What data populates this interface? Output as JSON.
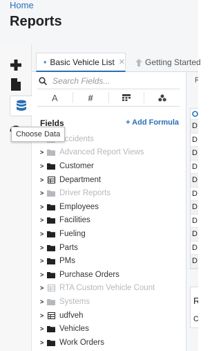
{
  "header": {
    "breadcrumb": "Home",
    "title": "Reports"
  },
  "rail": {
    "items": [
      {
        "icon": "plus-icon"
      },
      {
        "icon": "document-icon"
      },
      {
        "icon": "database-icon"
      },
      {
        "icon": "gauge-icon"
      }
    ]
  },
  "tabs": [
    {
      "label": "Basic Vehicle List",
      "icon": "bolt-icon",
      "active": true
    },
    {
      "label": "Getting Started",
      "icon": "up-arrow-icon",
      "active": false
    }
  ],
  "fields_panel": {
    "search_placeholder": "Search Fields...",
    "filters": [
      {
        "icon": "text-type-icon",
        "glyph": "A"
      },
      {
        "icon": "hash-icon",
        "glyph": "#"
      },
      {
        "icon": "grid-icon",
        "glyph": ""
      },
      {
        "icon": "circles-icon",
        "glyph": ""
      }
    ],
    "header": "Fields",
    "add_formula_label": "+ Add Formula",
    "tree": [
      {
        "label": "Accidents",
        "type": "folder",
        "disabled": true
      },
      {
        "label": "Advanced Report Views",
        "type": "folder",
        "disabled": true
      },
      {
        "label": "Customer",
        "type": "folder",
        "disabled": false
      },
      {
        "label": "Department",
        "type": "table",
        "disabled": false
      },
      {
        "label": "Driver Reports",
        "type": "folder",
        "disabled": true
      },
      {
        "label": "Employees",
        "type": "folder",
        "disabled": false
      },
      {
        "label": "Facilities",
        "type": "folder",
        "disabled": false
      },
      {
        "label": "Fueling",
        "type": "folder",
        "disabled": false
      },
      {
        "label": "Parts",
        "type": "folder",
        "disabled": false
      },
      {
        "label": "PMs",
        "type": "folder",
        "disabled": false
      },
      {
        "label": "Purchase Orders",
        "type": "folder",
        "disabled": false
      },
      {
        "label": "RTA Custom Vehicle Count",
        "type": "table",
        "disabled": true
      },
      {
        "label": "Systems",
        "type": "folder",
        "disabled": true
      },
      {
        "label": "udfveh",
        "type": "table",
        "disabled": false
      },
      {
        "label": "Vehicles",
        "type": "folder",
        "disabled": false
      },
      {
        "label": "Work Orders",
        "type": "folder",
        "disabled": false
      }
    ]
  },
  "tooltip": "Choose Data",
  "right_panel": {
    "label_fragment": "R",
    "cells": [
      "D",
      "D",
      "D",
      "D",
      "D",
      "D",
      "D",
      "D",
      "D",
      "D",
      "D"
    ],
    "card_title_fragment": "Re",
    "card_text_fragment": "C"
  },
  "colors": {
    "accent": "#2a6fb5",
    "disabled_text": "#b5b8bd",
    "background": "#f5f6f8"
  }
}
